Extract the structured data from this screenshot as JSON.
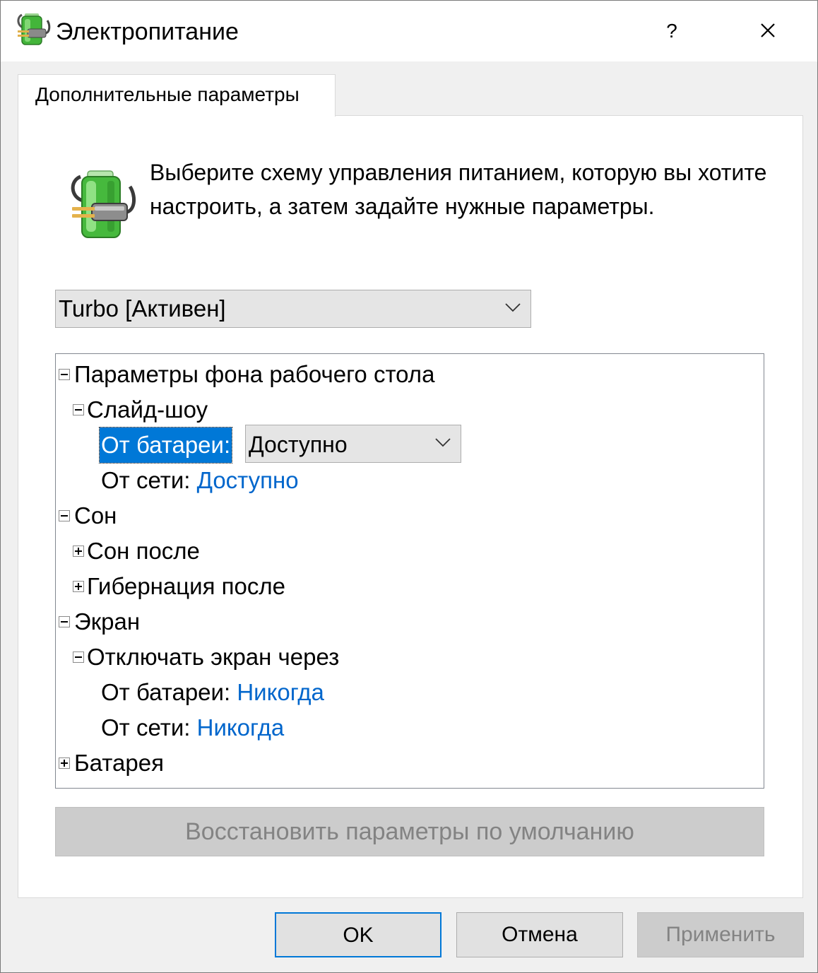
{
  "window": {
    "title": "Электропитание",
    "help_label": "?",
    "icon": "power-plug-battery-icon",
    "close_icon": "close-icon"
  },
  "tab": {
    "label": "Дополнительные параметры"
  },
  "intro": {
    "text": "Выберите схему управления питанием, которую вы хотите настроить, а затем задайте нужные параметры.",
    "icon": "power-plug-battery-icon"
  },
  "scheme_select": {
    "value": "Turbo [Активен]"
  },
  "tree": {
    "desktop_bg": {
      "label": "Параметры фона рабочего стола",
      "slideshow": {
        "label": "Слайд-шоу",
        "battery_label": "От батареи:",
        "battery_value": "Доступно",
        "ac_label": "От сети:",
        "ac_value": "Доступно"
      }
    },
    "sleep": {
      "label": "Сон",
      "sleep_after": "Сон после",
      "hibernate_after": "Гибернация после"
    },
    "display": {
      "label": "Экран",
      "turn_off": {
        "label": "Отключать экран через",
        "battery_label": "От батареи:",
        "battery_value": "Никогда",
        "ac_label": "От сети:",
        "ac_value": "Никогда"
      }
    },
    "battery": {
      "label": "Батарея"
    }
  },
  "restore_button": {
    "label": "Восстановить параметры по умолчанию"
  },
  "buttons": {
    "ok": "OK",
    "cancel": "Отмена",
    "apply": "Применить"
  },
  "colors": {
    "accent": "#0078d7",
    "link_value": "#0066cc",
    "disabled_text": "#838383",
    "battery_green": "#3cb043"
  }
}
